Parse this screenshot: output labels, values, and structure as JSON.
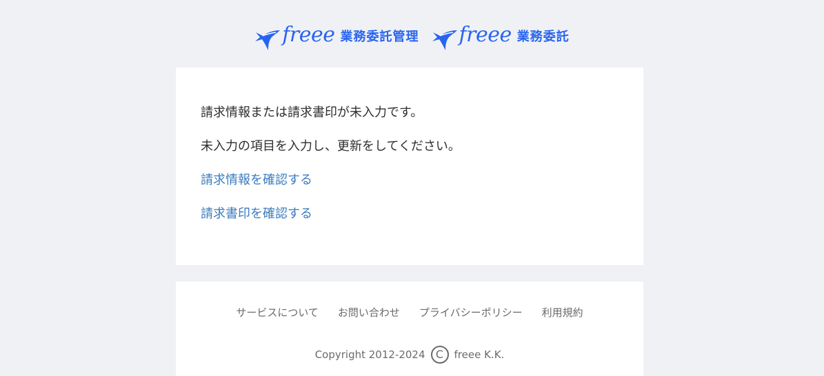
{
  "header": {
    "logos": [
      {
        "wordmark": "freee",
        "service": "業務委託管理"
      },
      {
        "wordmark": "freee",
        "service": "業務委託"
      }
    ]
  },
  "main": {
    "messages": [
      "請求情報または請求書印が未入力です。",
      "未入力の項目を入力し、更新をしてください。"
    ],
    "links": [
      "請求情報を確認する",
      "請求書印を確認する"
    ]
  },
  "footer": {
    "links": [
      "サービスについて",
      "お問い合わせ",
      "プライバシーポリシー",
      "利用規約"
    ],
    "copyright": {
      "prefix": "Copyright 2012-2024",
      "symbol": "C",
      "company": "freee K.K."
    }
  },
  "colors": {
    "page_background": "#f0f1f5",
    "card_background": "#ffffff",
    "brand_blue": "#2864f0",
    "link_blue": "#3b7bbd",
    "body_text": "#2e2e2e",
    "footer_text": "#6a6a6a"
  },
  "icons": {
    "logo_mark": "swallow-bird-icon",
    "copyright": "copyright-icon"
  }
}
